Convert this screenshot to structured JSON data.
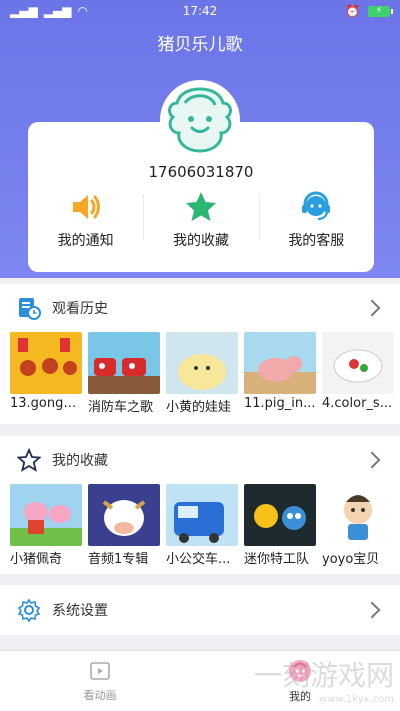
{
  "status": {
    "time": "17:42",
    "signal": "···",
    "wifi": "wifi"
  },
  "app": {
    "title": "猪贝乐儿歌"
  },
  "profile": {
    "phone": "17606031870"
  },
  "quick_actions": [
    {
      "label": "我的通知",
      "icon": "speaker-icon",
      "color": "#f5a623"
    },
    {
      "label": "我的收藏",
      "icon": "star-icon",
      "color": "#2bb673"
    },
    {
      "label": "我的客服",
      "icon": "headset-icon",
      "color": "#2a9fe0"
    }
  ],
  "history": {
    "title": "观看历史",
    "items": [
      {
        "caption": "13.gongxi..."
      },
      {
        "caption": "消防车之歌"
      },
      {
        "caption": "小黄的娃娃"
      },
      {
        "caption": "11.pig_in..."
      },
      {
        "caption": "4.color_s..."
      }
    ]
  },
  "favorites": {
    "title": "我的收藏",
    "items": [
      {
        "caption": "小猪佩奇"
      },
      {
        "caption": "音频1专辑"
      },
      {
        "caption": "小公交车..."
      },
      {
        "caption": "迷你特工队"
      },
      {
        "caption": "yoyo宝贝"
      }
    ]
  },
  "settings": {
    "title": "系统设置"
  },
  "nav": [
    {
      "label": "看动画",
      "icon": "play-icon"
    },
    {
      "label": "我的",
      "icon": "baby-face-icon"
    }
  ],
  "watermark": {
    "text": "一刻游戏网",
    "url": "www.1kyx.com"
  },
  "colors": {
    "header": "#6b75e8",
    "accent": "#2bb673"
  }
}
